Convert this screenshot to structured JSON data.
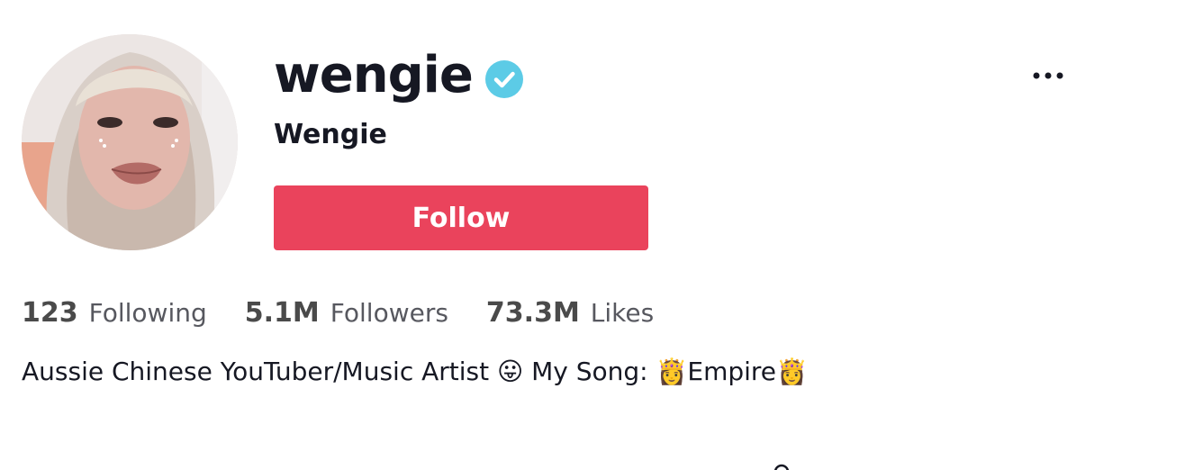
{
  "profile": {
    "username": "wengie",
    "nickname": "Wengie",
    "verified": true,
    "verified_color": "#5ccbe6",
    "avatar_alt": "wengie avatar"
  },
  "actions": {
    "follow_label": "Follow",
    "follow_color": "#ea435c",
    "more_icon": "more-horizontal-icon"
  },
  "stats": [
    {
      "value": "123",
      "label": "Following"
    },
    {
      "value": "5.1M",
      "label": "Followers"
    },
    {
      "value": "73.3M",
      "label": "Likes"
    }
  ],
  "bio": {
    "text_before": "Aussie Chinese YouTuber/Music Artist ",
    "emoji_1": "😛",
    "text_middle": " My Song: ",
    "emoji_2": "👸",
    "text_song": "Empire",
    "emoji_3": "👸"
  }
}
